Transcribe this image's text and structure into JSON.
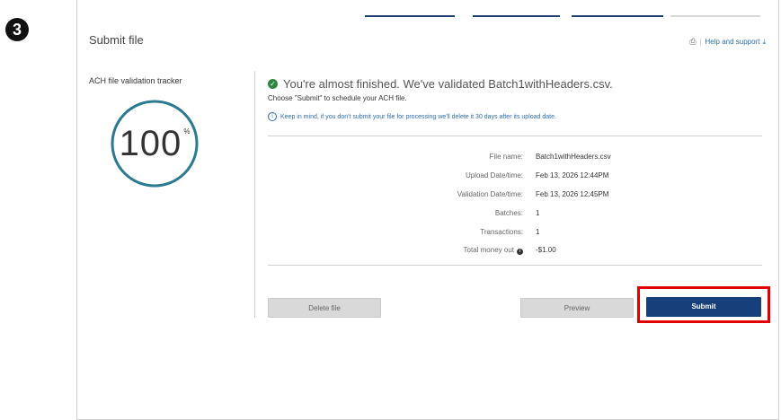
{
  "step": {
    "number": "3"
  },
  "header": {
    "title": "Submit file",
    "help_label": "Help and support",
    "print_icon": "printer-icon",
    "download_icon": "download-icon"
  },
  "progress": {
    "segments": [
      "complete",
      "complete",
      "complete",
      "incomplete"
    ]
  },
  "tracker": {
    "label": "ACH file validation tracker",
    "percent_value": "100",
    "percent_symbol": "%",
    "progress_fraction": 1.0,
    "color": "#2b7a91"
  },
  "status": {
    "headline": "You're almost finished. We've validated Batch1withHeaders.csv.",
    "instruction": "Choose \"Submit\" to schedule your ACH file.",
    "notice": "Keep in mind, if you don't submit your file for processing we'll delete it 30 days after its upload date."
  },
  "details": [
    {
      "label": "File name:",
      "value": "Batch1withHeaders.csv"
    },
    {
      "label": "Upload Date/time:",
      "value": "Feb 13, 2026 12:44PM"
    },
    {
      "label": "Validation Date/time:",
      "value": "Feb 13, 2026 12:45PM"
    },
    {
      "label": "Batches:",
      "value": "1"
    },
    {
      "label": "Transactions:",
      "value": "1"
    },
    {
      "label": "Total money out",
      "value": "-$1.00"
    }
  ],
  "buttons": {
    "delete": "Delete file",
    "preview": "Preview",
    "submit": "Submit"
  },
  "colors": {
    "primary": "#173f7a",
    "success": "#2e8540",
    "link": "#2b6cb0",
    "highlight": "#e00000"
  }
}
